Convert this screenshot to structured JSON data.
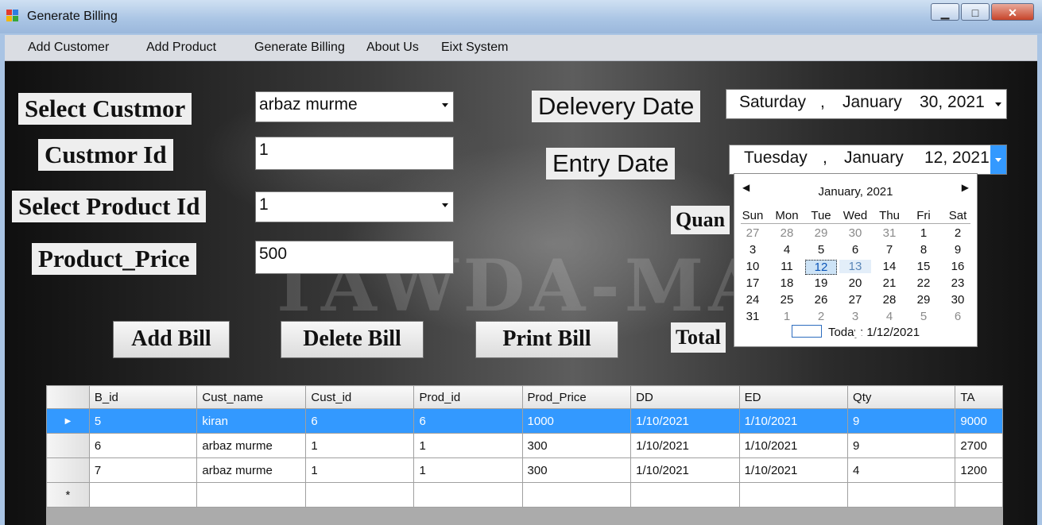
{
  "window": {
    "title": "Generate Billing",
    "controls": [
      "▁",
      "□",
      "✕"
    ]
  },
  "menu": [
    "Add Customer",
    "Add Product",
    "Generate Billing",
    "About Us",
    "Eixt System"
  ],
  "background_text": "TAWDA-MAN",
  "form": {
    "select_customer_label": "Select Custmor",
    "customer_value": "arbaz murme",
    "customer_id_label": "Custmor Id",
    "customer_id_value": "1",
    "product_id_label": "Select Product Id",
    "product_id_value": "1",
    "product_price_label": "Product_Price",
    "product_price_value": "500",
    "delivery_date_label": "Delevery Date",
    "delivery_date": {
      "weekday": "Saturday",
      "sep": ",",
      "month": "January",
      "day_year": "30, 2021"
    },
    "entry_date_label": "Entry Date",
    "entry_date": {
      "weekday": "Tuesday",
      "sep": ",",
      "month": "January",
      "day_year": "12, 2021"
    },
    "quantity_label_partial": "Quan",
    "total_label_partial": "Total"
  },
  "buttons": {
    "add": "Add Bill",
    "delete": "Delete Bill",
    "print": "Print Bill"
  },
  "calendar": {
    "month_label": "January, 2021",
    "prev": "◀",
    "next": "▶",
    "weekdays": [
      "Sun",
      "Mon",
      "Tue",
      "Wed",
      "Thu",
      "Fri",
      "Sat"
    ],
    "weeks": [
      [
        "27",
        "28",
        "29",
        "30",
        "31",
        "1",
        "2"
      ],
      [
        "3",
        "4",
        "5",
        "6",
        "7",
        "8",
        "9"
      ],
      [
        "10",
        "11",
        "12",
        "13",
        "14",
        "15",
        "16"
      ],
      [
        "17",
        "18",
        "19",
        "20",
        "21",
        "22",
        "23"
      ],
      [
        "24",
        "25",
        "26",
        "27",
        "28",
        "29",
        "30"
      ],
      [
        "31",
        "1",
        "2",
        "3",
        "4",
        "5",
        "6"
      ]
    ],
    "selected": "12",
    "hovered": "13",
    "today_text": "Today: 1/12/2021"
  },
  "grid": {
    "columns": [
      "B_id",
      "Cust_name",
      "Cust_id",
      "Prod_id",
      "Prod_Price",
      "DD",
      "ED",
      "Qty",
      "TA"
    ],
    "rows": [
      [
        "5",
        "kiran",
        "6",
        "6",
        "1000",
        "1/10/2021",
        "1/10/2021",
        "9",
        "9000"
      ],
      [
        "6",
        "arbaz murme",
        "1",
        "1",
        "300",
        "1/10/2021",
        "1/10/2021",
        "9",
        "2700"
      ],
      [
        "7",
        "arbaz murme",
        "1",
        "1",
        "300",
        "1/10/2021",
        "1/10/2021",
        "4",
        "1200"
      ]
    ],
    "selected_row": 0,
    "current_row_marker": "▶",
    "new_row_marker": "*"
  },
  "colors": {
    "selection": "#3399ff",
    "title_bar": "#a9c4e4",
    "close_button": "#c7442a"
  }
}
